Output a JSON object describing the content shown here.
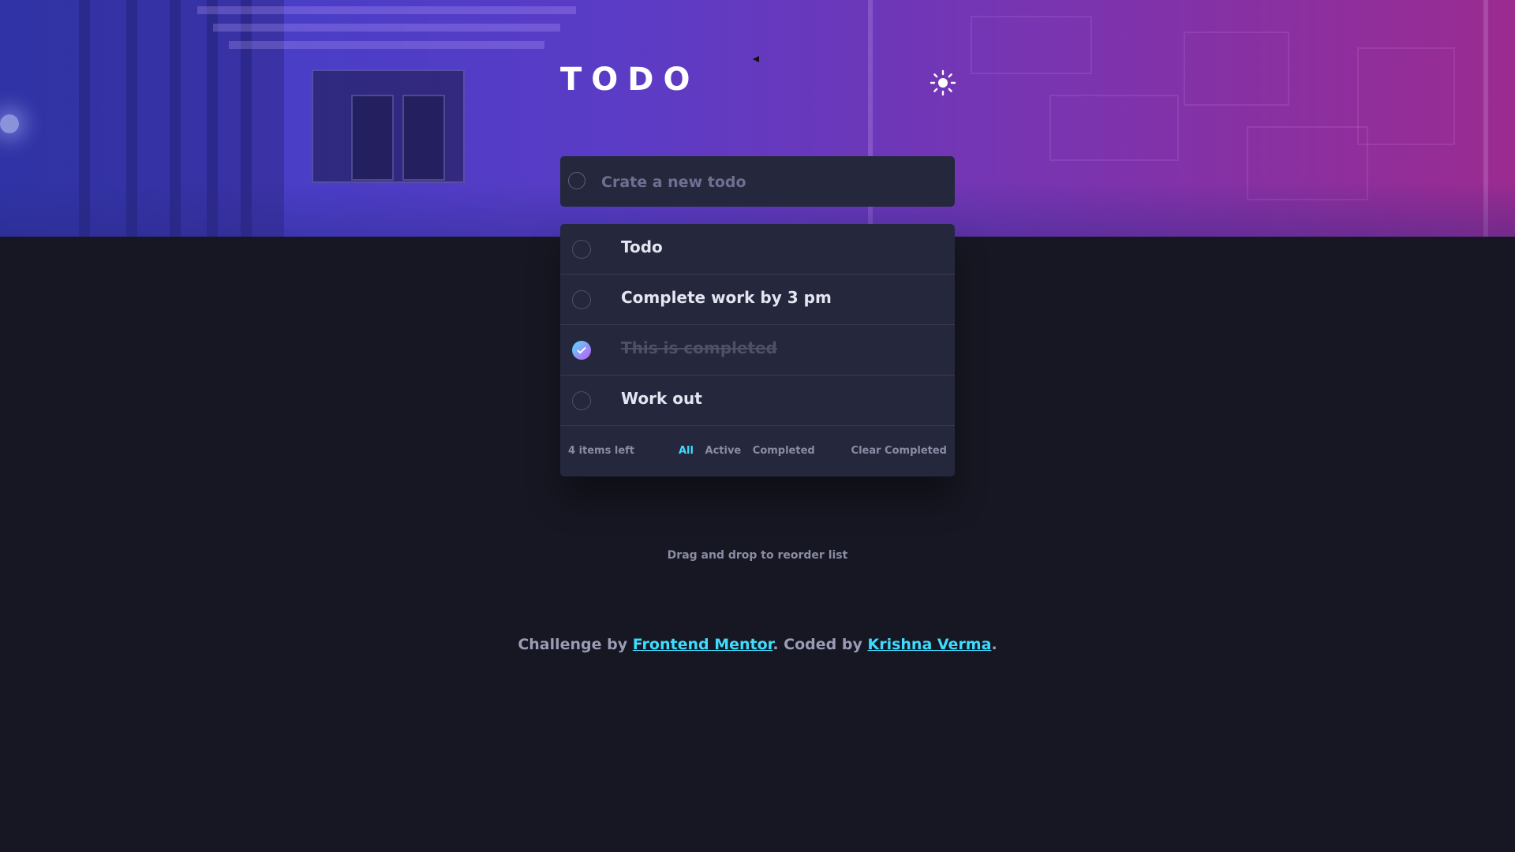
{
  "header": {
    "title": "TODO",
    "theme_toggle_icon": "sun-icon"
  },
  "new_todo": {
    "placeholder": "Crate a new todo",
    "value": ""
  },
  "todos": [
    {
      "text": "Todo",
      "completed": false
    },
    {
      "text": "Complete work by 3 pm",
      "completed": false
    },
    {
      "text": "This is completed",
      "completed": true
    },
    {
      "text": "Work out",
      "completed": false
    }
  ],
  "footer": {
    "items_left": "4 items left",
    "filters": [
      "All",
      "Active",
      "Completed"
    ],
    "active_filter": "All",
    "clear_label": "Clear Completed"
  },
  "hint": "Drag and drop to reorder list",
  "attribution": {
    "prefix": "Challenge by",
    "link1": "Frontend Mentor",
    "middle": ". Coded by",
    "link2": "Krishna Verma",
    "suffix": "."
  },
  "colors": {
    "background": "#161722",
    "card": "#25273c",
    "accent": "#3fdcff",
    "check_gradient_start": "#57ddff",
    "check_gradient_end": "#c058f3"
  }
}
